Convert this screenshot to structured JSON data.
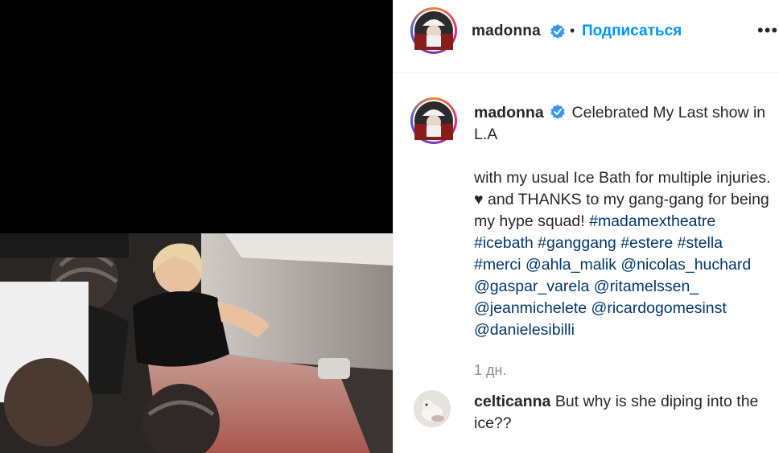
{
  "post": {
    "username": "madonna",
    "follow_label": "Подписаться",
    "separator": "•",
    "more_label": "•••",
    "caption": {
      "line1": "Celebrated My Last show in L.A",
      "line2": "with my usual Ice Bath for multiple injuries. ♥ and THANKS to my gang-gang for being my hype squad!",
      "hashtags": [
        "#madamextheatre",
        "#icebath",
        "#ganggang",
        "#estere",
        "#stella",
        "#merci"
      ],
      "mentions": [
        "@ahla_malik",
        "@nicolas_huchard",
        "@gaspar_varela",
        "@ritamelssen_",
        "@jeanmichelete",
        "@ricardogomesinst",
        "@danielesibilli"
      ]
    },
    "time_ago": "1 дн."
  },
  "comments": [
    {
      "username": "celticanna",
      "text": "But why is she diping into the ice??"
    }
  ],
  "colors": {
    "link_blue": "#0095f6",
    "hashtag": "#00376b",
    "verified": "#3897f0",
    "muted": "#8e8e8e"
  }
}
